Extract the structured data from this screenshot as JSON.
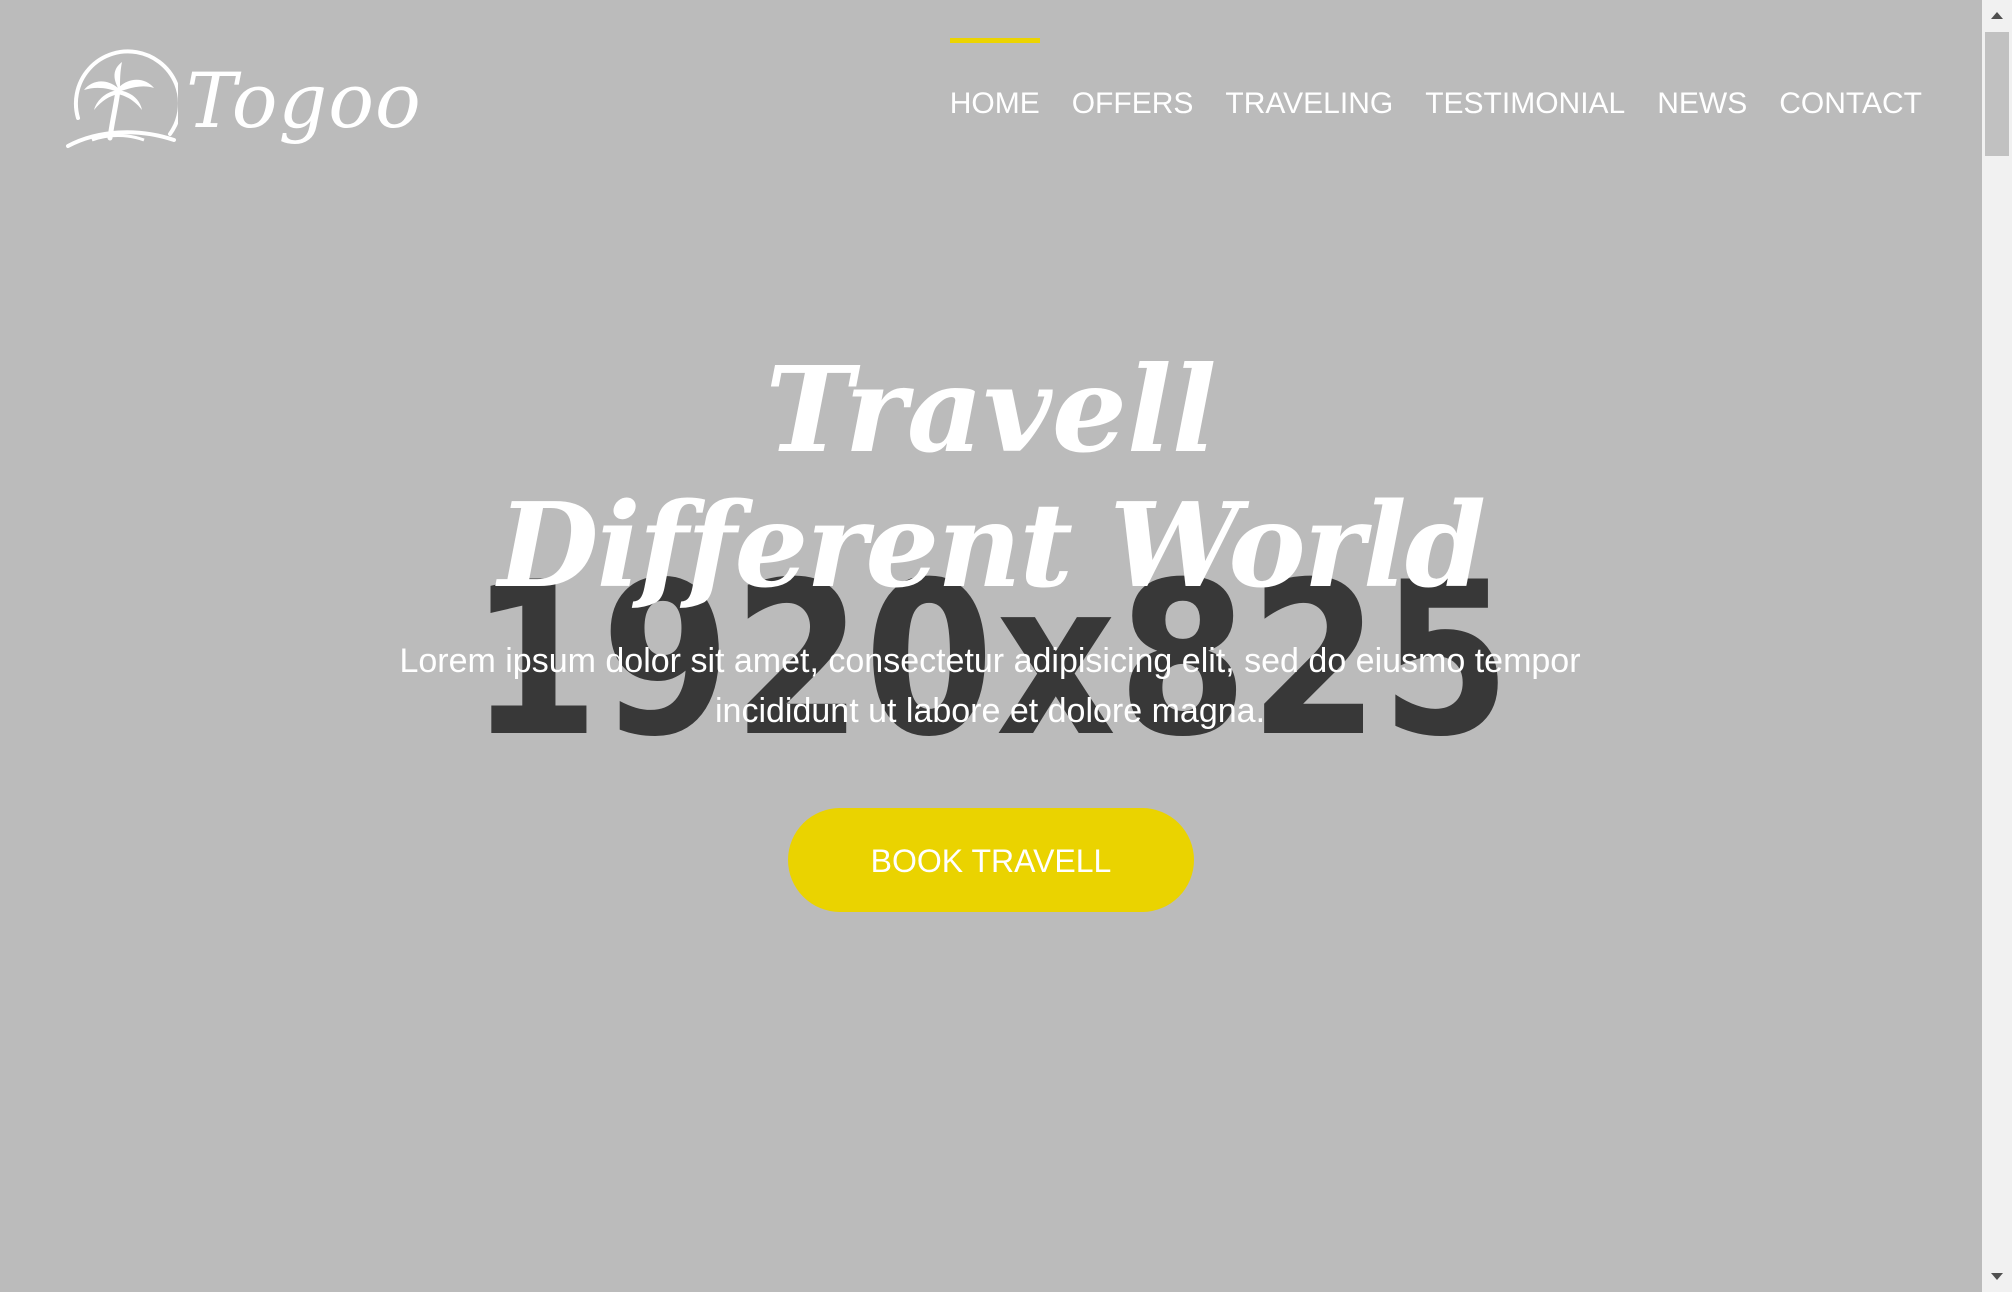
{
  "header": {
    "logo_text": "Togoo",
    "nav": [
      {
        "label": "HOME",
        "active": true
      },
      {
        "label": "OFFERS",
        "active": false
      },
      {
        "label": "TRAVELING",
        "active": false
      },
      {
        "label": "TESTIMONIAL",
        "active": false
      },
      {
        "label": "NEWS",
        "active": false
      },
      {
        "label": "CONTACT",
        "active": false
      }
    ]
  },
  "hero": {
    "placeholder_text": "1920x825",
    "script_title": "Travell",
    "title": "Different World",
    "description": "Lorem ipsum dolor sit amet, consectetur adipisicing elit, sed do eiusmo tempor incididunt ut labore et dolore magna.",
    "cta_label": "BOOK TRAVELL"
  },
  "colors": {
    "background": "#bbbbbb",
    "accent": "#ead300",
    "text": "#ffffff",
    "placeholder": "#383838"
  }
}
